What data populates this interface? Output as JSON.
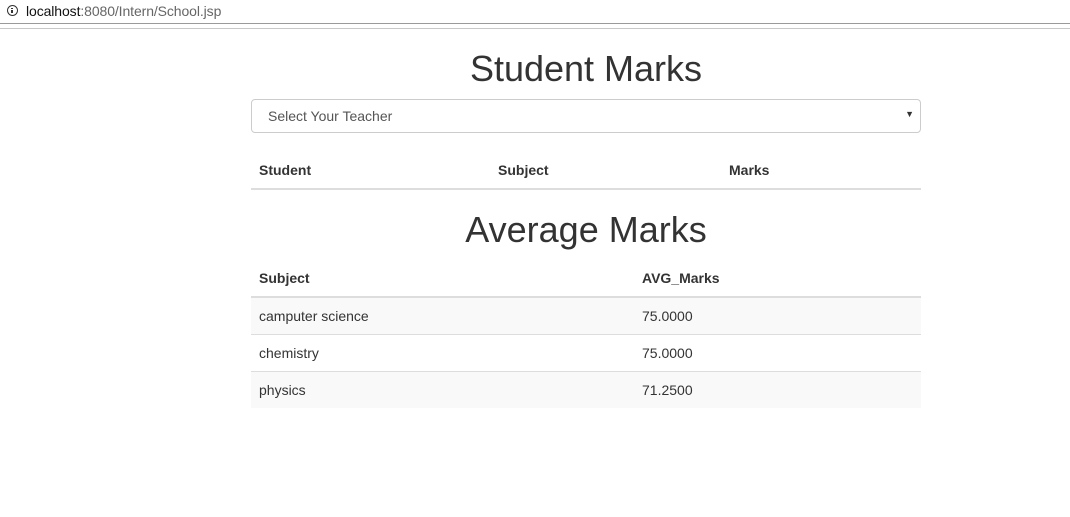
{
  "browser": {
    "url_host": "localhost",
    "url_path": ":8080/Intern/School.jsp"
  },
  "student_marks": {
    "title": "Student Marks",
    "teacher_select": {
      "selected": "Select Your Teacher"
    },
    "columns": [
      "Student",
      "Subject",
      "Marks"
    ]
  },
  "average_marks": {
    "title": "Average Marks",
    "columns": [
      "Subject",
      "AVG_Marks"
    ],
    "rows": [
      {
        "subject": "camputer science",
        "avg": "75.0000"
      },
      {
        "subject": "chemistry",
        "avg": "75.0000"
      },
      {
        "subject": "physics",
        "avg": "71.2500"
      }
    ]
  }
}
